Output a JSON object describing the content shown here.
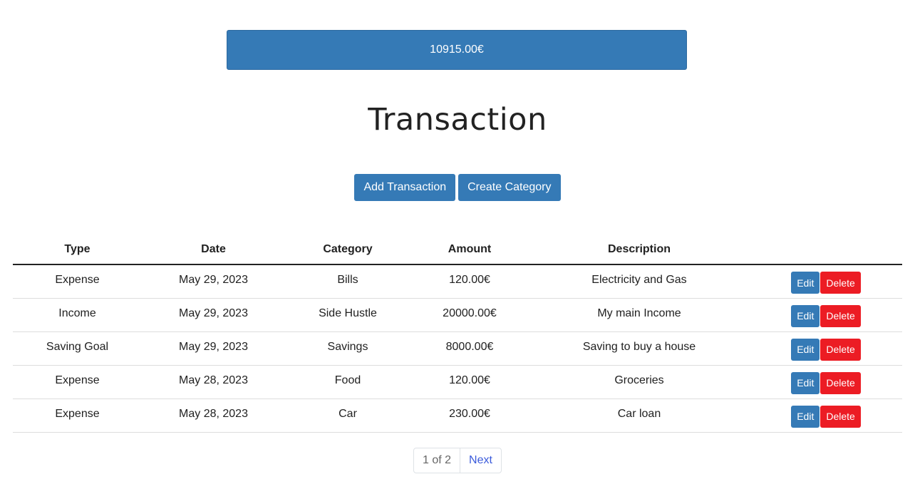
{
  "balance": "10915.00€",
  "page_title": "Transaction",
  "actions": {
    "add_transaction": "Add Transaction",
    "create_category": "Create Category"
  },
  "table": {
    "headers": [
      "Type",
      "Date",
      "Category",
      "Amount",
      "Description",
      ""
    ],
    "rows": [
      {
        "type": "Expense",
        "date": "May 29, 2023",
        "category": "Bills",
        "amount": "120.00€",
        "description": "Electricity and Gas"
      },
      {
        "type": "Income",
        "date": "May 29, 2023",
        "category": "Side Hustle",
        "amount": "20000.00€",
        "description": "My main Income"
      },
      {
        "type": "Saving Goal",
        "date": "May 29, 2023",
        "category": "Savings",
        "amount": "8000.00€",
        "description": "Saving to buy a house"
      },
      {
        "type": "Expense",
        "date": "May 28, 2023",
        "category": "Food",
        "amount": "120.00€",
        "description": "Groceries"
      },
      {
        "type": "Expense",
        "date": "May 28, 2023",
        "category": "Car",
        "amount": "230.00€",
        "description": "Car loan"
      }
    ],
    "edit_label": "Edit",
    "delete_label": "Delete"
  },
  "pagination": {
    "info": "1 of 2",
    "next": "Next"
  },
  "colors": {
    "primary": "#357ab6",
    "danger": "#ec1c24",
    "link": "#3b5bdb"
  }
}
